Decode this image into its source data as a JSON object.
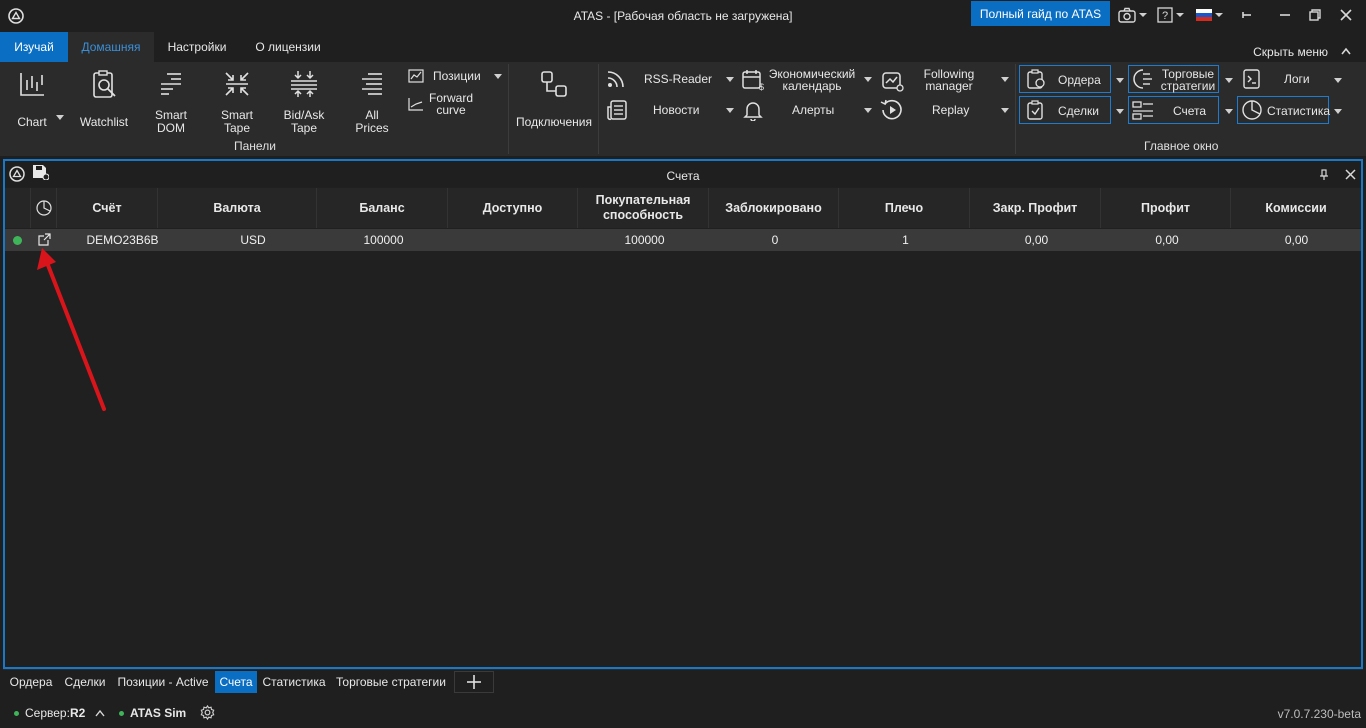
{
  "window": {
    "title": "ATAS - [Рабочая область не загружена]",
    "guide_button": "Полный гайд по ATAS"
  },
  "ribbon_tabs": {
    "learn": "Изучай",
    "home": "Домашняя",
    "settings": "Настройки",
    "license": "О лицензии",
    "hide_menu": "Скрыть меню"
  },
  "panels_group": {
    "label": "Панели",
    "chart": "Chart",
    "watchlist": "Watchlist",
    "smart_dom_1": "Smart",
    "smart_dom_2": "DOM",
    "smart_tape_1": "Smart",
    "smart_tape_2": "Tape",
    "bidask_1": "Bid/Ask",
    "bidask_2": "Tape",
    "all_prices_1": "All",
    "all_prices_2": "Prices",
    "positions": "Позиции",
    "forward_curve_1": "Forward",
    "forward_curve_2": "curve"
  },
  "connections": "Подключения",
  "tools": {
    "rss": "RSS-Reader",
    "news": "Новости",
    "calendar_1": "Экономический",
    "calendar_2": "календарь",
    "alerts": "Алерты",
    "following_1": "Following",
    "following_2": "manager",
    "replay": "Replay"
  },
  "main_window_group": {
    "label": "Главное окно",
    "orders": "Ордера",
    "deals": "Сделки",
    "strategies_1": "Торговые",
    "strategies_2": "стратегии",
    "accounts": "Счета",
    "logs": "Логи",
    "statistics": "Статистика"
  },
  "panel": {
    "title": "Счета",
    "columns": [
      "Счёт",
      "Валюта",
      "Баланс",
      "Доступно",
      "Покупательная способность",
      "Заблокировано",
      "Плечо",
      "Закр. Профит",
      "Профит",
      "Комиссии"
    ],
    "row": {
      "account": "DEMO23B6B",
      "currency": "USD",
      "balance": "100000",
      "available": "",
      "buying_power": "100000",
      "blocked": "0",
      "leverage": "1",
      "closed_profit": "0,00",
      "profit": "0,00",
      "commission": "0,00"
    }
  },
  "bottom_tabs": [
    "Ордера",
    "Сделки",
    "Позиции - Active",
    "Счета",
    "Статистика",
    "Торговые стратегии"
  ],
  "status_bar": {
    "server_label": "Сервер: ",
    "server_value": "R2",
    "sim": "ATAS Sim",
    "version": "v7.0.7.230-beta"
  },
  "colors": {
    "accent": "#0a6ec2",
    "online": "#3fb55a",
    "annotation_arrow": "#d9151b"
  },
  "icons": [
    "atas-logo-icon",
    "camera-icon",
    "help-icon",
    "flag-ru-icon",
    "pin-icon",
    "close-icon",
    "save-icon",
    "pie-chart-icon",
    "external-link-icon",
    "gear-icon",
    "plus-icon"
  ]
}
